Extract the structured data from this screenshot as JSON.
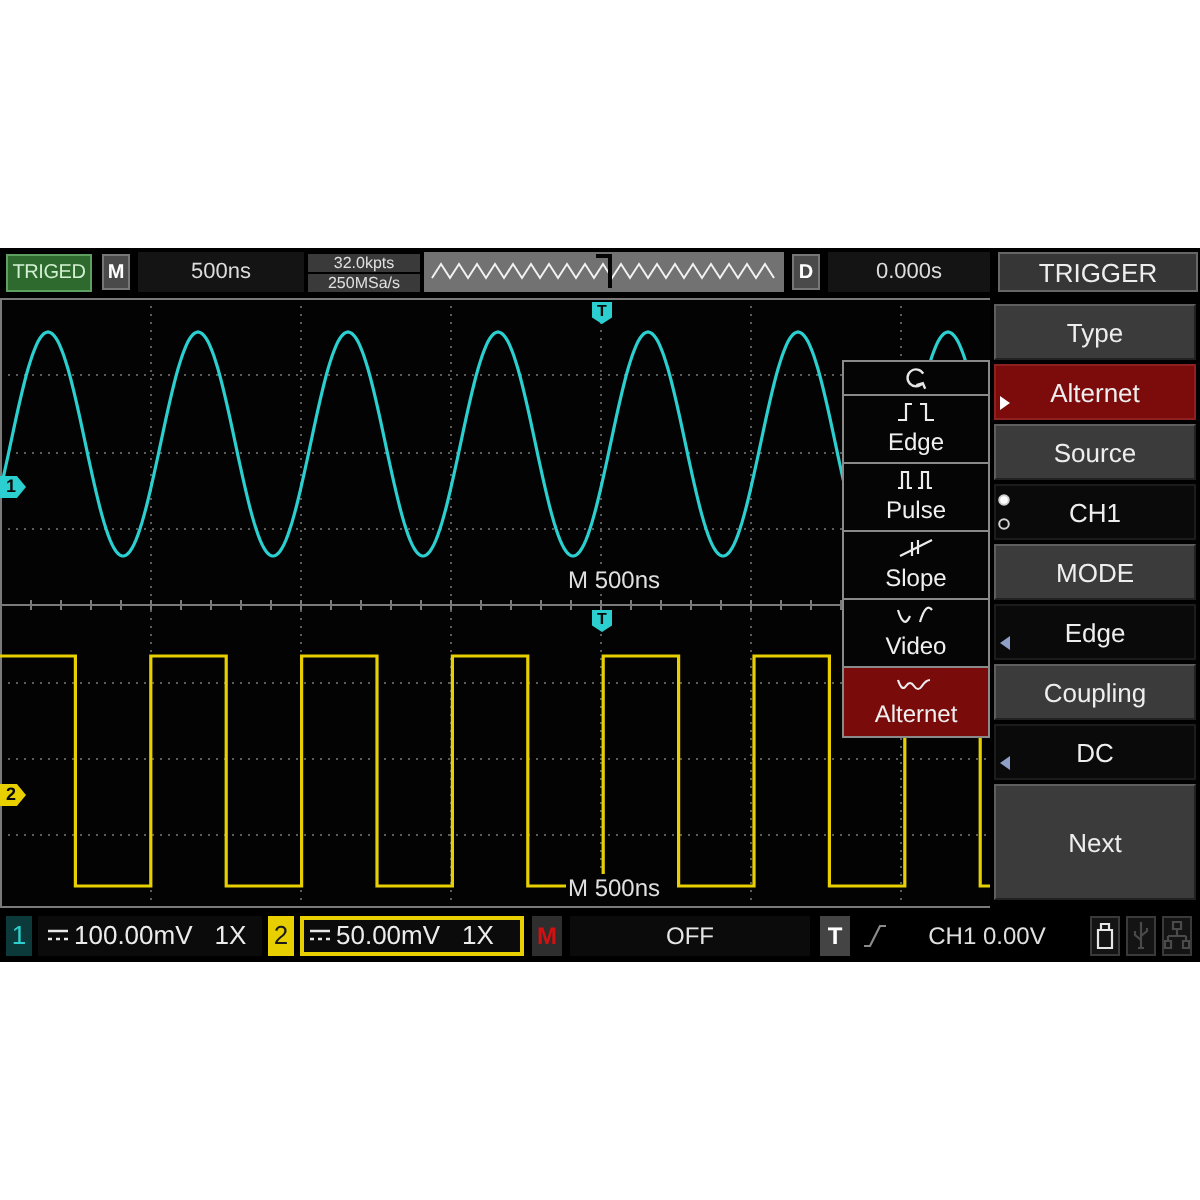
{
  "top_bar": {
    "trigger_status": "TRIGED",
    "mode_badge": "M",
    "timebase": "500ns",
    "memory_depth": "32.0kpts",
    "sample_rate": "250MSa/s",
    "delay_badge": "D",
    "delay": "0.000s"
  },
  "menu": {
    "title": "TRIGGER",
    "items": [
      {
        "kind": "title",
        "label": "Type"
      },
      {
        "kind": "value",
        "label": "Alternet",
        "active": true,
        "expanded": true
      },
      {
        "kind": "title",
        "label": "Source"
      },
      {
        "kind": "choice",
        "label": "CH1",
        "options": [
          {
            "selected": true
          },
          {
            "selected": false
          }
        ]
      },
      {
        "kind": "title",
        "label": "MODE"
      },
      {
        "kind": "value",
        "label": "Edge",
        "active": false,
        "expanded": false
      },
      {
        "kind": "title",
        "label": "Coupling"
      },
      {
        "kind": "value",
        "label": "DC",
        "active": false,
        "expanded": false
      },
      {
        "kind": "button",
        "label": "Next"
      }
    ]
  },
  "type_popup": {
    "items": [
      {
        "label": "Edge",
        "selected": false
      },
      {
        "label": "Pulse",
        "selected": false
      },
      {
        "label": "Slope",
        "selected": false
      },
      {
        "label": "Video",
        "selected": false
      },
      {
        "label": "Alternet",
        "selected": true
      }
    ]
  },
  "display": {
    "panels": [
      {
        "label": "M 500ns",
        "trigger_marker": "T"
      },
      {
        "label": "M 500ns",
        "trigger_marker": "T"
      }
    ]
  },
  "channels": [
    {
      "kind": "sine",
      "marker": "1",
      "color": "#2ccfcf",
      "number": "1",
      "scale": "100.00mV",
      "probe": "1X",
      "selected": false
    },
    {
      "kind": "square",
      "marker": "2",
      "color": "#e8d000",
      "number": "2",
      "scale": "50.00mV",
      "probe": "1X",
      "selected": true
    }
  ],
  "bottom_bar": {
    "math_badge": "M",
    "math_state": "OFF",
    "trigger_badge": "T",
    "trigger_info": "CH1 0.00V",
    "indicators": [
      {
        "on": true
      },
      {
        "on": false
      },
      {
        "on": false
      }
    ]
  }
}
